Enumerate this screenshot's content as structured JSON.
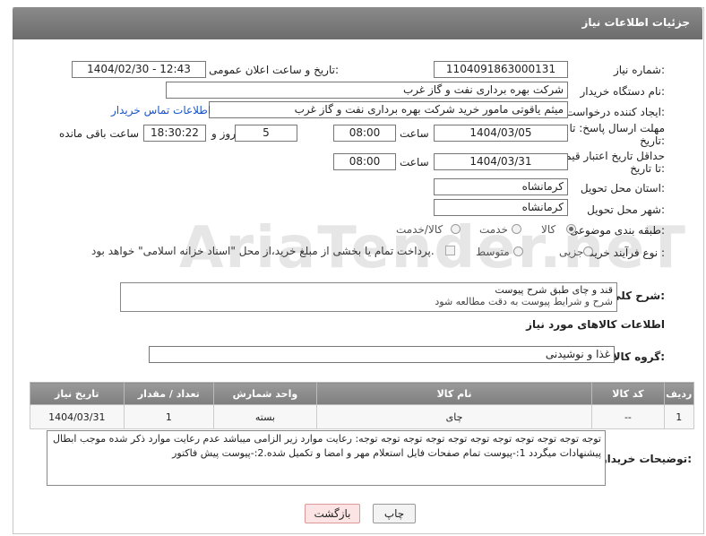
{
  "header": {
    "title": "جزئیات اطلاعات نیاز"
  },
  "fields": {
    "need_number": {
      "label": "شماره نیاز:",
      "value": "1104091863000131"
    },
    "announce": {
      "label": "تاریخ و ساعت اعلان عمومی:",
      "value": "1404/02/30 - 12:43"
    },
    "buyer_org": {
      "label": "نام دستگاه خریدار:",
      "value": "شرکت بهره برداری نفت و گاز غرب"
    },
    "creator": {
      "label": "ایجاد کننده درخواست:",
      "value": "میثم یاقوتی مامور خرید شرکت بهره برداری نفت و گاز غرب",
      "link": "اطلاعات تماس خریدار"
    },
    "reply_deadline": {
      "label": "مهلت ارسال پاسخ: تا تاریخ:",
      "date": "1404/03/05",
      "time_label": "ساعت",
      "time": "08:00",
      "days": "5",
      "days_label": "روز و",
      "remaining": "18:30:22",
      "remaining_label": "ساعت باقی مانده"
    },
    "price_validity": {
      "label": "حداقل تاریخ اعتبار قیمت: تا تاریخ:",
      "date": "1404/03/31",
      "time_label": "ساعت",
      "time": "08:00"
    },
    "province": {
      "label": "استان محل تحویل:",
      "value": "کرمانشاه"
    },
    "city": {
      "label": "شهر محل تحویل:",
      "value": "کرمانشاه"
    },
    "category": {
      "label": "طبقه بندی موضوعی:",
      "options": [
        "کالا",
        "خدمت",
        "کالا/خدمت"
      ],
      "selected": "کالا"
    },
    "process": {
      "label": "نوع فرآیند خرید :",
      "options": [
        "جزیی",
        "متوسط"
      ],
      "selected": "",
      "payment_note": "پرداخت تمام یا بخشی از مبلغ خرید،از محل \"اسناد خزانه اسلامی\" خواهد بود."
    },
    "description": {
      "label": "شرح كلي نياز:",
      "line1": "قند و چای طبق شرح پیوست",
      "line2": "شرح و شرایط پیوست به دقت مطالعه شود"
    }
  },
  "goods_section": {
    "title": "اطلاعات کالاهای مورد نیاز"
  },
  "goods_group": {
    "label": "گروه کالا:",
    "value": "غذا و نوشیدنی"
  },
  "table": {
    "headers": [
      "ردیف",
      "کد کالا",
      "نام کالا",
      "واحد شمارش",
      "تعداد / مقدار",
      "تاریخ نیاز"
    ],
    "rows": [
      [
        "1",
        "--",
        "چای",
        "بسته",
        "1",
        "1404/03/31"
      ]
    ]
  },
  "buyer_notes": {
    "label": "توضیحات خریدار:",
    "text": "توجه توجه توجه توجه توجه توجه توجه توجه توجه توجه توجه: رعایت موارد زیر الزامی میباشد عدم رعایت موارد ذکر شده موجب ابطال پیشنهادات میگردد 1:-پیوست تمام صفحات  فایل استعلام مهر و امضا و تکمیل شده.2:-پیوست پیش فاکتور"
  },
  "buttons": {
    "print": "چاپ",
    "back": "بازگشت"
  },
  "colors": {
    "header": "#7a7a7a",
    "link": "#1a55c8",
    "back_button": "#fde4e4"
  }
}
